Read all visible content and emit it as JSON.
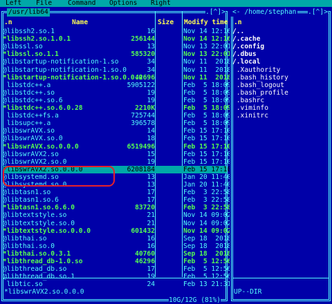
{
  "menu": [
    "Left",
    "File",
    "Command",
    "Options",
    "Right"
  ],
  "left_panel": {
    "path": " /usr/lib64 ",
    "corner": ".[^]>",
    "headers": {
      "name": "Name",
      "size": "Size",
      "modify": "Modify time",
      "sort": ".n"
    },
    "rows": [
      {
        "name": "@libssh2.so.1",
        "size": "16",
        "time": "Nov 14 12:16",
        "kind": "link"
      },
      {
        "name": "*libssh2.so.1.0.1",
        "size": "256144",
        "time": "Nov 14 12:16",
        "kind": "exec"
      },
      {
        "name": "@libssl.so",
        "size": "13",
        "time": "Nov 13 22:01",
        "kind": "link"
      },
      {
        "name": "*libssl.so.1.1",
        "size": "585320",
        "time": "Nov 13 22:01",
        "kind": "exec"
      },
      {
        "name": "@libstartup-notification-1.so",
        "size": "34",
        "time": "Nov 11  2018",
        "kind": "link"
      },
      {
        "name": "@libstartup-notification-1.so.0",
        "size": "34",
        "time": "Nov 11  2018",
        "kind": "link"
      },
      {
        "name": "*libstartup-notification-1.so.0.0.0",
        "size": "42696",
        "time": "Nov 11  2018",
        "kind": "exec"
      },
      {
        "name": " libstdc++.a",
        "size": "5905122",
        "time": "Feb  5 18:09",
        "kind": "file"
      },
      {
        "name": "@libstdc++.so",
        "size": "19",
        "time": "Feb  5 18:09",
        "kind": "link"
      },
      {
        "name": "@libstdc++.so.6",
        "size": "19",
        "time": "Feb  5 18:09",
        "kind": "link"
      },
      {
        "name": "*libstdc++.so.6.0.28",
        "size": "2210K",
        "time": "Feb  5 18:09",
        "kind": "exec"
      },
      {
        "name": " libstdc++fs.a",
        "size": "725744",
        "time": "Feb  5 18:09",
        "kind": "file"
      },
      {
        "name": " libsupc++.a",
        "size": "396578",
        "time": "Feb  5 18:09",
        "kind": "file"
      },
      {
        "name": "@libswrAVX.so",
        "size": "14",
        "time": "Feb 15 17:10",
        "kind": "link"
      },
      {
        "name": "@libswrAVX.so.0",
        "size": "18",
        "time": "Feb 15 17:10",
        "kind": "link"
      },
      {
        "name": "*libswrAVX.so.0.0.0",
        "size": "6519496",
        "time": "Feb 15 17:10",
        "kind": "exec"
      },
      {
        "name": "@libswrAVX2.so",
        "size": "15",
        "time": "Feb 15 17:10",
        "kind": "link"
      },
      {
        "name": "@libswrAVX2.so.0",
        "size": "19",
        "time": "Feb 15 17:10",
        "kind": "link"
      },
      {
        "name": "*libswrAVX2.so.0.0.0",
        "size": "6208184",
        "time": "Feb 15 17:10",
        "kind": "sel"
      },
      {
        "name": "@libsystemd.so",
        "size": "13",
        "time": "Jan 20 11:40",
        "kind": "link"
      },
      {
        "name": "@libsystemd.so.0",
        "size": "13",
        "time": "Jan 20 11:40",
        "kind": "link"
      },
      {
        "name": "@libtasn1.so",
        "size": "17",
        "time": "Feb  3 22:58",
        "kind": "link"
      },
      {
        "name": "@libtasn1.so.6",
        "size": "17",
        "time": "Feb  3 22:58",
        "kind": "link"
      },
      {
        "name": "*libtasn1.so.6.6.0",
        "size": "83720",
        "time": "Feb  3 22:58",
        "kind": "exec"
      },
      {
        "name": "@libtextstyle.so",
        "size": "21",
        "time": "Nov 14 09:02",
        "kind": "link"
      },
      {
        "name": "@libtextstyle.so.0",
        "size": "21",
        "time": "Nov 14 09:02",
        "kind": "link"
      },
      {
        "name": "*libtextstyle.so.0.0.0",
        "size": "601432",
        "time": "Nov 14 09:02",
        "kind": "exec"
      },
      {
        "name": "@libthai.so",
        "size": "16",
        "time": "Sep 18  2018",
        "kind": "link"
      },
      {
        "name": "@libthai.so.0",
        "size": "16",
        "time": "Sep 18  2018",
        "kind": "link"
      },
      {
        "name": "*libthai.so.0.3.1",
        "size": "40760",
        "time": "Sep 18  2018",
        "kind": "exec"
      },
      {
        "name": "*libthread_db-1.0.so",
        "size": "46296",
        "time": "Feb  5 12:56",
        "kind": "exec"
      },
      {
        "name": "@libthread_db.so",
        "size": "17",
        "time": "Feb  5 12:56",
        "kind": "link"
      },
      {
        "name": "@libthread_db.so.1",
        "size": "19",
        "time": "Feb  5 12:56",
        "kind": "link"
      },
      {
        "name": " libtic.so",
        "size": "24",
        "time": "Feb 13 21:31",
        "kind": "file"
      }
    ],
    "status": "*libswrAVX2.so.0.0.0",
    "disk": "10G/12G (81%)"
  },
  "right_panel": {
    "path": "<- /home/stephan",
    "corner": ".[^]>",
    "headers": {
      "sort": ".n"
    },
    "rows": [
      {
        "name": "/..",
        "kind": "dir"
      },
      {
        "name": "/.cache",
        "kind": "dir"
      },
      {
        "name": "/.config",
        "kind": "dir"
      },
      {
        "name": "/.dbus",
        "kind": "dir"
      },
      {
        "name": "/.local",
        "kind": "dir"
      },
      {
        "name": " .Xauthority",
        "kind": "file"
      },
      {
        "name": " .bash_history",
        "kind": "file"
      },
      {
        "name": " .bash_logout",
        "kind": "file"
      },
      {
        "name": " .bash_profile",
        "kind": "file"
      },
      {
        "name": " .bashrc",
        "kind": "file"
      },
      {
        "name": " .viminfo",
        "kind": "file"
      },
      {
        "name": " .xinitrc",
        "kind": "file"
      }
    ],
    "status": "UP--DIR"
  },
  "colors": {
    "panel_bg": "#0000a8",
    "cyan": "#54fcfc",
    "exec_green": "#54fc54",
    "header_yellow": "#fcfc54",
    "highlight": "#e8202a"
  }
}
